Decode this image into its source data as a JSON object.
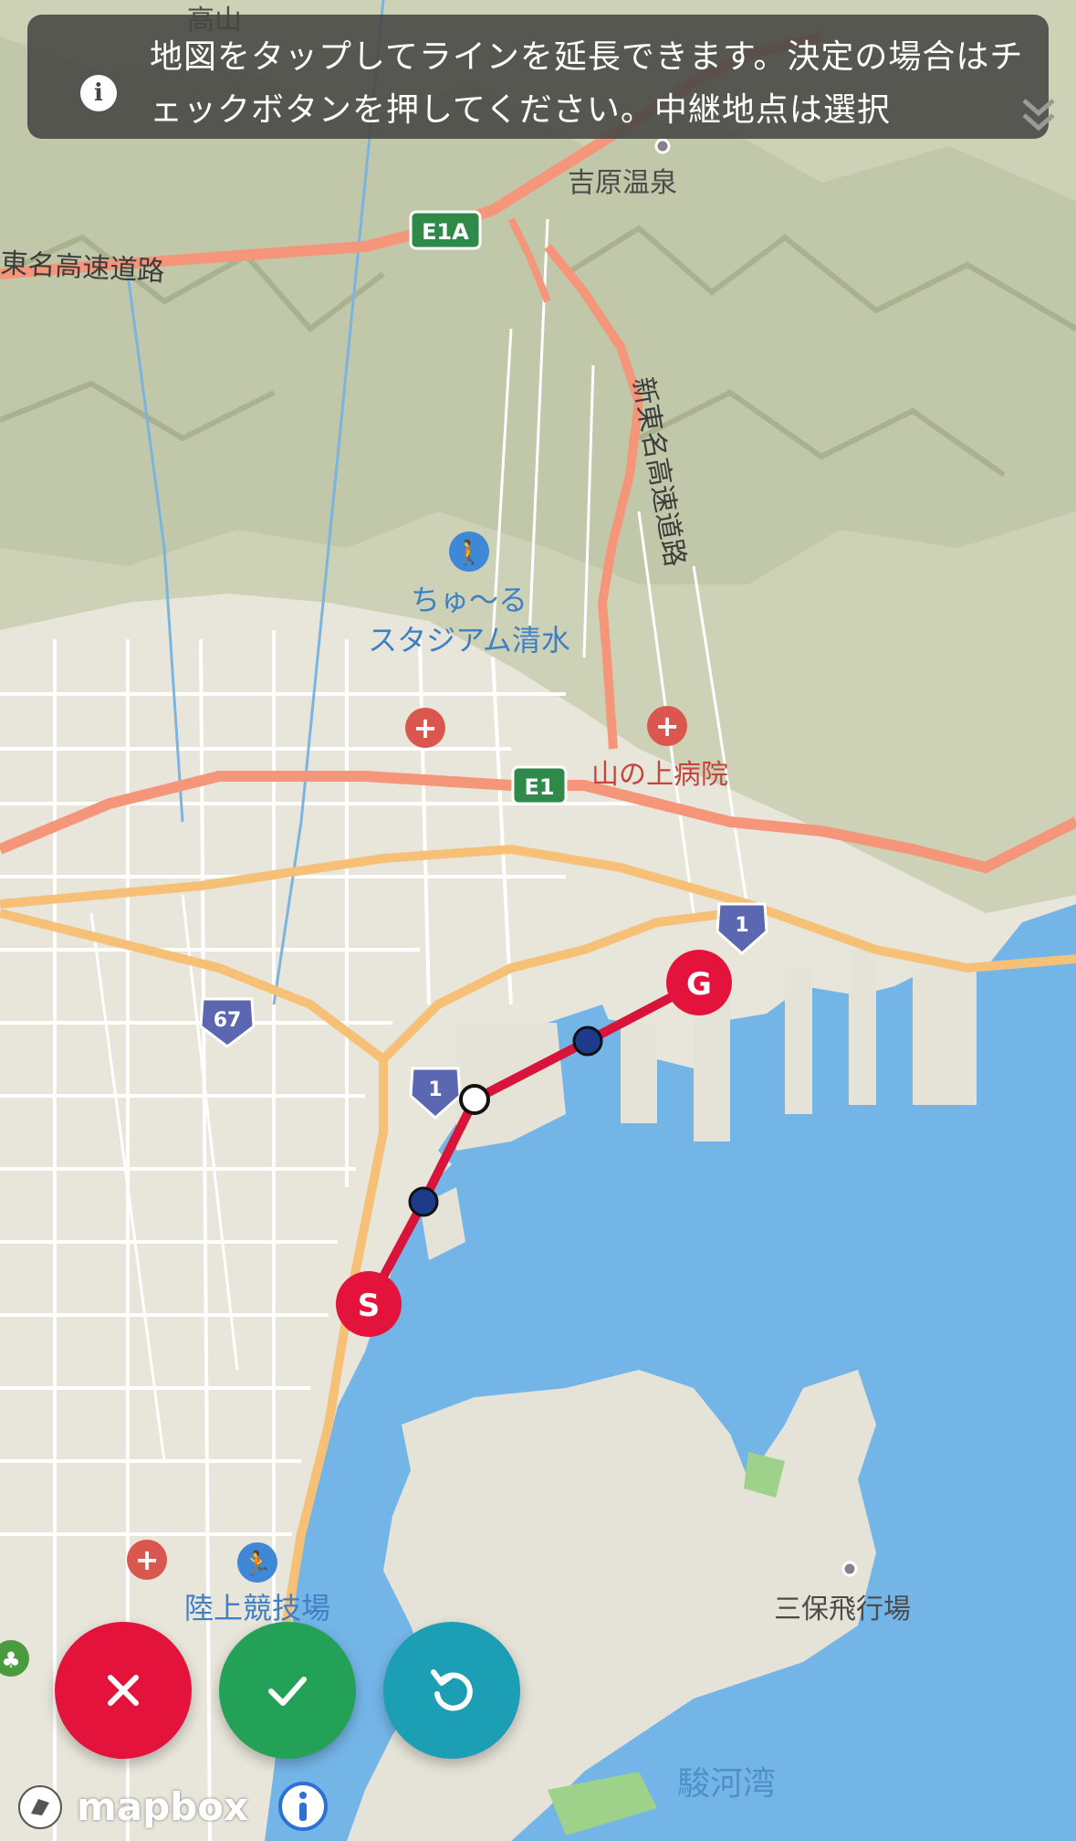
{
  "banner": {
    "message": "地図をタップしてラインを延長できます。決定の場合はチェックボタンを押してください。中継地点は選択",
    "icon": "info-icon",
    "expand_icon": "chevron-double-down-icon"
  },
  "map": {
    "labels": {
      "takayama": "高山",
      "yoshiwara_onsen": "吉原温泉",
      "tomei_expressway": "東名高速道路",
      "shin_tomei_expressway": "新東名高速道路",
      "stadium_line1": "ちゅ～る",
      "stadium_line2": "スタジアム清水",
      "yamanoue_hospital": "山の上病院",
      "athletics_stadium": "陸上競技場",
      "miho_airfield": "三保飛行場",
      "suruga_bay": "駿河湾"
    },
    "shields": {
      "e1a": "E1A",
      "e1": "E1",
      "route1_a": "1",
      "route1_b": "1",
      "route67": "67"
    },
    "route_markers": {
      "start": "S",
      "goal": "G"
    }
  },
  "buttons": {
    "cancel_icon": "close-icon",
    "confirm_icon": "check-icon",
    "undo_icon": "undo-icon"
  },
  "attribution": {
    "logo_text": "mapbox",
    "info_icon": "info-circle-icon"
  },
  "colors": {
    "route_line": "#d9143a",
    "start_goal_marker": "#e3133c",
    "waypoint": "#1e3a8a",
    "cancel_button": "#e3133c",
    "confirm_button": "#23a257",
    "undo_button": "#1c9eb4",
    "water": "#74b5e8",
    "expressway": "#f5967a"
  }
}
